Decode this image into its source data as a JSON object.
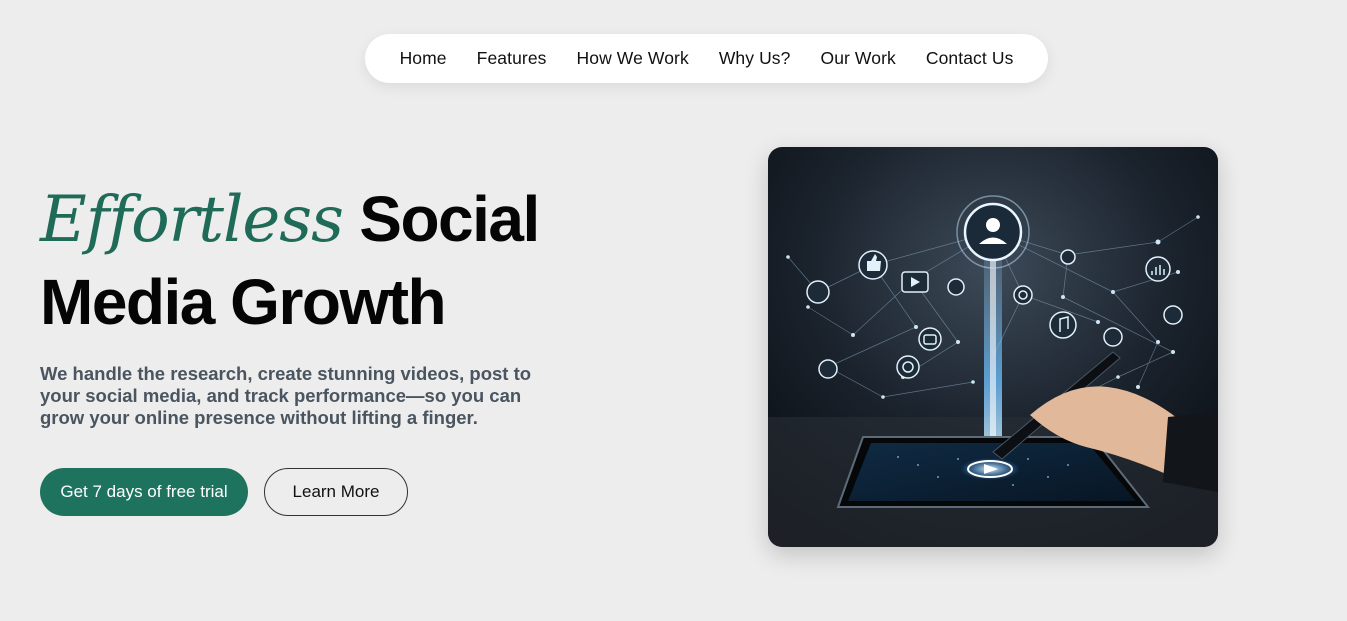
{
  "nav": {
    "items": [
      {
        "label": "Home"
      },
      {
        "label": "Features"
      },
      {
        "label": "How We Work"
      },
      {
        "label": "Why Us?"
      },
      {
        "label": "Our Work"
      },
      {
        "label": "Contact Us"
      }
    ]
  },
  "hero": {
    "title_accent": "Effortless",
    "title_rest_line1": "Social",
    "title_line2": "Media Growth",
    "description": "We handle the research, create stunning videos, post to your social media, and track performance—so you can grow your online presence without lifting a finger.",
    "primary_cta": "Get 7 days of free trial",
    "secondary_cta": "Learn More"
  },
  "colors": {
    "accent": "#1f6b58",
    "primary_button": "#1e735f",
    "background": "#ededed"
  },
  "icons": [
    "user-icon",
    "thumbs-up-icon",
    "play-icon",
    "music-note-icon",
    "chart-icon",
    "camera-icon",
    "chat-icon",
    "globe-icon",
    "pen-icon",
    "tablet-icon"
  ]
}
